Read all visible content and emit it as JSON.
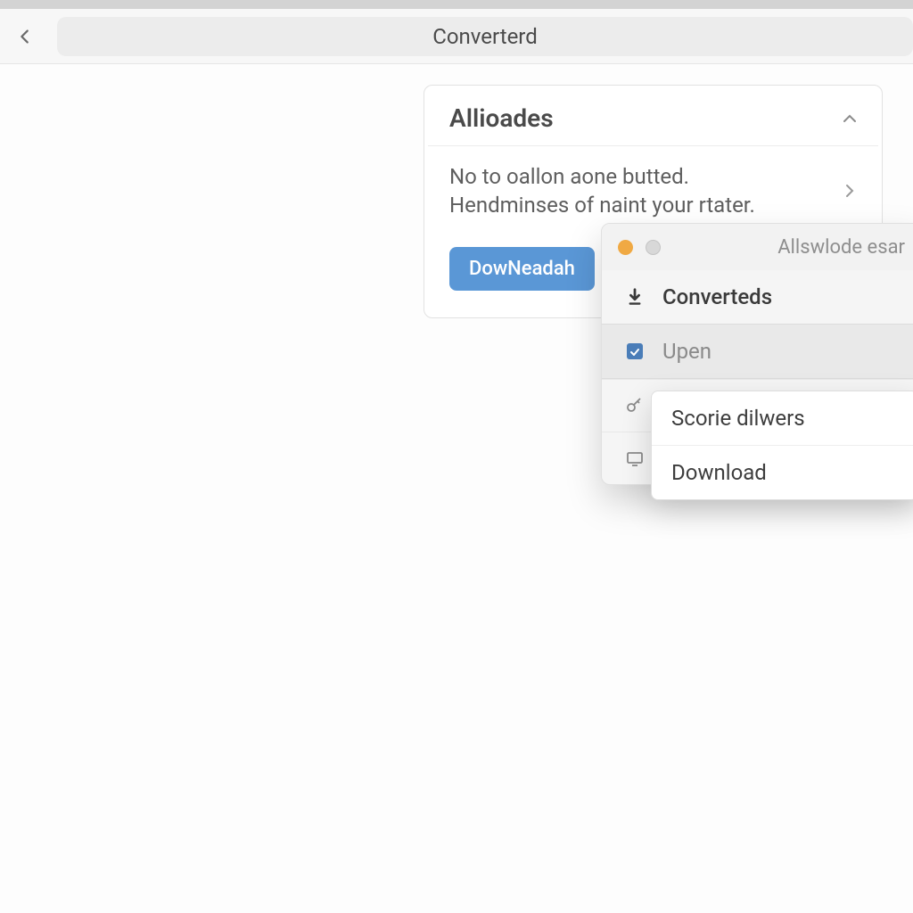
{
  "toolbar": {
    "address": "Converterd"
  },
  "card": {
    "title": "Allioades",
    "line1": "No to oallon aone butted.",
    "line2": "Hendminses of naint your rtater.",
    "button": "DowNeadah"
  },
  "popover": {
    "title": "Allswlode esar",
    "rows": [
      {
        "icon": "download-arrow-icon",
        "label": "Converteds"
      },
      {
        "icon": "app-box-icon",
        "label": "Upen"
      },
      {
        "icon": "key-icon",
        "label": ""
      },
      {
        "icon": "device-icon",
        "label": ""
      }
    ]
  },
  "submenu": {
    "items": [
      "Scorie dilwers",
      "Download"
    ]
  }
}
